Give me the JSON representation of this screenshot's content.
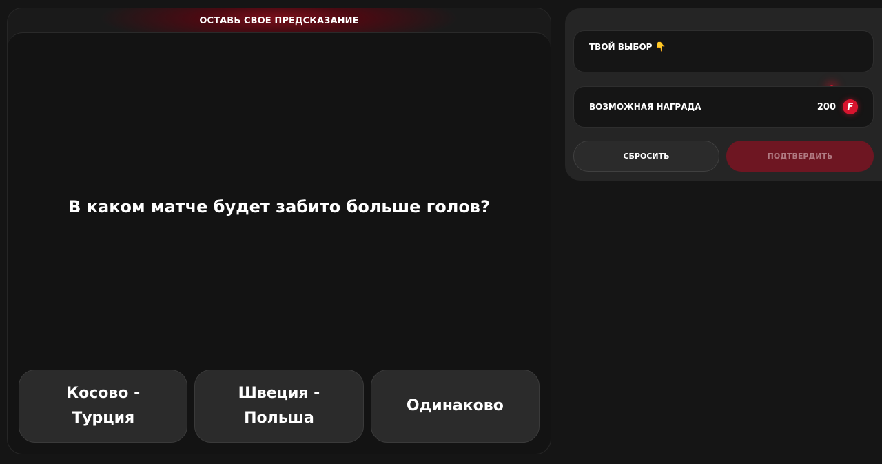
{
  "header": {
    "title": "ОСТАВЬ СВОЕ ПРЕДСКАЗАНИЕ"
  },
  "question": {
    "text": "В каком матче будет забито больше голов?"
  },
  "options": [
    {
      "label": "Косово - Турция"
    },
    {
      "label": "Швеция - Польша"
    },
    {
      "label": "Одинаково"
    }
  ],
  "side": {
    "choice_label": "ТВОЙ ВЫБОР",
    "choice_icon": "pointing-down-hand-icon",
    "choice_icon_glyph": "👇",
    "reward_label": "ВОЗМОЖНАЯ НАГРАДА",
    "reward_value": "200",
    "coin_icon": "f-coin-icon",
    "coin_letter": "F",
    "reset_label": "СБРОСИТЬ",
    "confirm_label": "ПОДТВЕРДИТЬ"
  },
  "colors": {
    "accent": "#d8142e",
    "confirm_button": "#6e1622",
    "background": "#151515"
  }
}
